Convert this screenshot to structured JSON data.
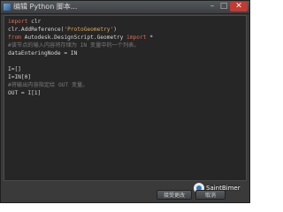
{
  "window": {
    "title": "编辑 Python 脚本..."
  },
  "code_lines": [
    [
      {
        "t": "import",
        "c": "kw"
      },
      {
        "t": " clr",
        "c": "txt"
      }
    ],
    [
      {
        "t": "clr.AddReference(",
        "c": "txt"
      },
      {
        "t": "'ProtoGeometry'",
        "c": "str"
      },
      {
        "t": ")",
        "c": "txt"
      }
    ],
    [
      {
        "t": "from",
        "c": "kw"
      },
      {
        "t": " Autodesk.DesignScript.Geometry ",
        "c": "txt"
      },
      {
        "t": "import",
        "c": "kw"
      },
      {
        "t": " *",
        "c": "txt"
      }
    ],
    [
      {
        "t": "#该节点的输入内容将存储为 IN 变量中的一个列表。",
        "c": "cmt"
      }
    ],
    [
      {
        "t": "dataEnteringNode = IN",
        "c": "txt"
      }
    ],
    [
      {
        "t": "",
        "c": "txt"
      }
    ],
    [
      {
        "t": "I=[]",
        "c": "txt"
      }
    ],
    [
      {
        "t": "I=IN[0]",
        "c": "txt"
      }
    ],
    [
      {
        "t": "#将输出内容指定给 OUT 变量。",
        "c": "cmt"
      }
    ],
    [
      {
        "t": "OUT = I[1]",
        "c": "txt"
      }
    ]
  ],
  "footer": {
    "accept_label": "接受更改",
    "cancel_label": "取消",
    "watermark": "SaintBimer"
  },
  "window_controls": {
    "minimize": "–",
    "maximize": "□",
    "close": "✕"
  },
  "colors": {
    "keyword": "#e06a4d",
    "string": "#dba85a",
    "comment": "#7a7a7a",
    "text": "#d6d6d6",
    "editor_bg": "#262626"
  }
}
